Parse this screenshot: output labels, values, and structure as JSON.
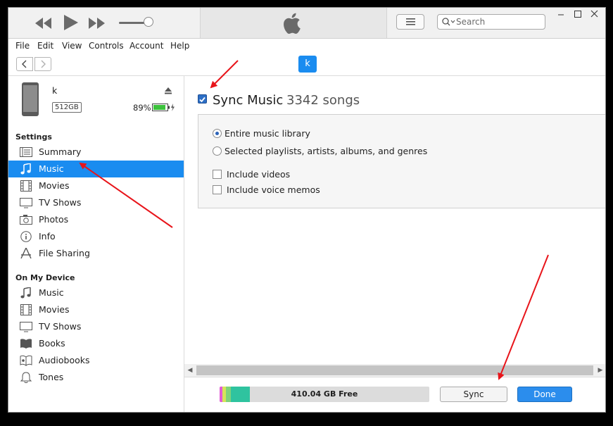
{
  "toolbar": {
    "search_placeholder": "Search"
  },
  "menu": [
    "File",
    "Edit",
    "View",
    "Controls",
    "Account",
    "Help"
  ],
  "nav": {
    "device_chip": "k"
  },
  "device": {
    "name": "k",
    "capacity": "512GB",
    "battery": "89%"
  },
  "sidebar": {
    "settings_header": "Settings",
    "settings_items": [
      {
        "label": "Summary",
        "icon": "summary-icon"
      },
      {
        "label": "Music",
        "icon": "music-note-icon",
        "selected": true
      },
      {
        "label": "Movies",
        "icon": "film-icon"
      },
      {
        "label": "TV Shows",
        "icon": "tv-icon"
      },
      {
        "label": "Photos",
        "icon": "camera-icon"
      },
      {
        "label": "Info",
        "icon": "info-icon"
      },
      {
        "label": "File Sharing",
        "icon": "app-store-icon"
      }
    ],
    "device_header": "On My Device",
    "device_items": [
      {
        "label": "Music",
        "icon": "music-note-icon"
      },
      {
        "label": "Movies",
        "icon": "film-icon"
      },
      {
        "label": "TV Shows",
        "icon": "tv-icon"
      },
      {
        "label": "Books",
        "icon": "book-icon"
      },
      {
        "label": "Audiobooks",
        "icon": "audiobook-icon"
      },
      {
        "label": "Tones",
        "icon": "bell-icon"
      }
    ]
  },
  "main": {
    "sync_label": "Sync Music",
    "sync_count": "3342 songs",
    "sync_checked": true,
    "options": {
      "entire_library": "Entire music library",
      "selected": "Selected playlists, artists, albums, and genres",
      "include_videos": "Include videos",
      "include_voice_memos": "Include voice memos"
    }
  },
  "footer": {
    "free_space": "410.04 GB Free",
    "sync_button": "Sync",
    "done_button": "Done"
  },
  "colors": {
    "accent": "#1a8cf0",
    "annotation": "#e8141a",
    "storage_segments": [
      "#e25bd6",
      "#d7e35a",
      "#7fd37a",
      "#2fc39f"
    ]
  }
}
